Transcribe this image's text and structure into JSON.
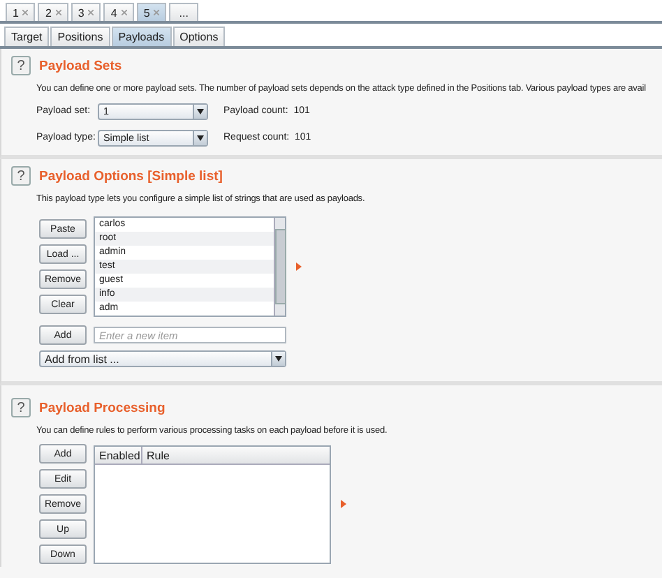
{
  "attack_tabs": [
    {
      "label": "1",
      "selected": false
    },
    {
      "label": "2",
      "selected": false
    },
    {
      "label": "3",
      "selected": false
    },
    {
      "label": "4",
      "selected": false
    },
    {
      "label": "5",
      "selected": true
    },
    {
      "label": "...",
      "selected": false,
      "kind": "more"
    }
  ],
  "tabs": [
    {
      "label": "Target",
      "selected": false
    },
    {
      "label": "Positions",
      "selected": false
    },
    {
      "label": "Payloads",
      "selected": true
    },
    {
      "label": "Options",
      "selected": false
    }
  ],
  "payload_sets": {
    "help": "?",
    "title": "Payload Sets",
    "description": "You can define one or more payload sets. The number of payload sets depends on the attack type defined in the Positions tab. Various payload types are avail",
    "fields": [
      {
        "label": "Payload set:",
        "value": "1",
        "info": "Payload count:  101"
      },
      {
        "label": "Payload type:",
        "value": "Simple list",
        "info": "Request count:  101"
      }
    ]
  },
  "payload_options": {
    "help": "?",
    "title": "Payload Options [Simple list]",
    "description": "This payload type lets you configure a simple list of strings that are used as payloads.",
    "buttons": [
      "Paste",
      "Load ...",
      "Remove",
      "Clear"
    ],
    "items": [
      "carlos",
      "root",
      "admin",
      "test",
      "guest",
      "info",
      "adm"
    ],
    "add_button": "Add",
    "new_item": {
      "placeholder": "Enter a new item"
    },
    "add_from_list": "Add from list ..."
  },
  "payload_processing": {
    "help": "?",
    "title": "Payload Processing",
    "description": "You can define rules to perform various processing tasks on each payload before it is used.",
    "buttons": [
      "Add",
      "Edit",
      "Remove",
      "Up",
      "Down"
    ],
    "table": {
      "columns": [
        "Enabled",
        "Rule"
      ]
    }
  }
}
